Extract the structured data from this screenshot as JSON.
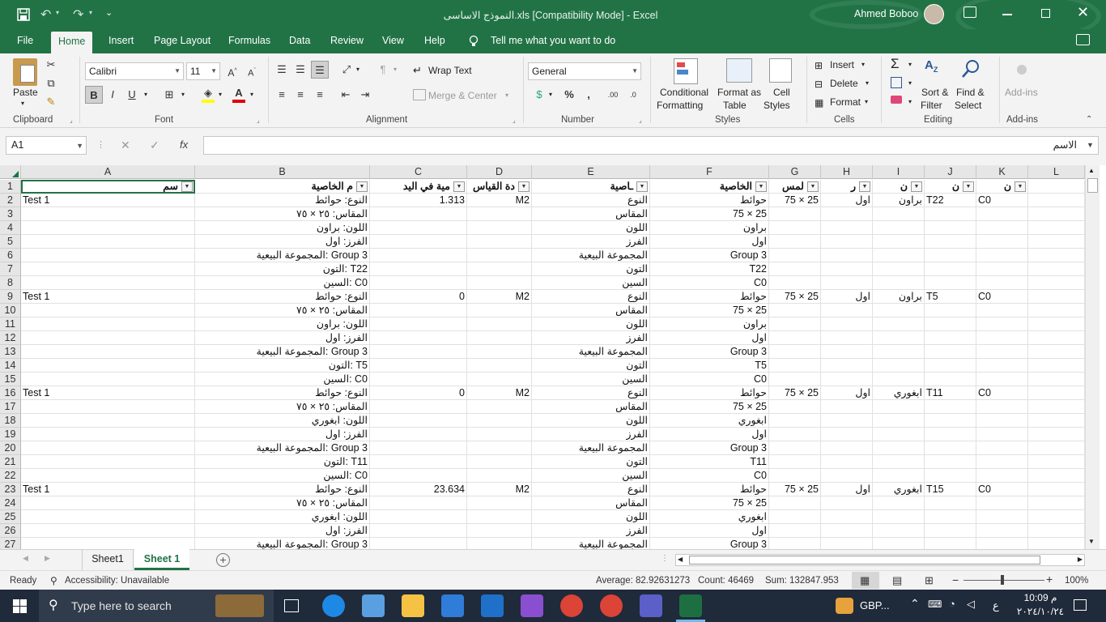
{
  "window": {
    "title": "النموذج الاساسى.xls  [Compatibility Mode]  -  Excel",
    "user": "Ahmed Boboo"
  },
  "ribbon_tabs": [
    "File",
    "Home",
    "Insert",
    "Page Layout",
    "Formulas",
    "Data",
    "Review",
    "View",
    "Help"
  ],
  "tell_me": "Tell me what you want to do",
  "clipboard": {
    "paste": "Paste",
    "label": "Clipboard"
  },
  "font": {
    "name": "Calibri",
    "size": "11",
    "bold": "B",
    "italic": "I",
    "underline": "U",
    "label": "Font"
  },
  "alignment": {
    "wrap": "Wrap Text",
    "merge": "Merge & Center",
    "label": "Alignment"
  },
  "number": {
    "format": "General",
    "label": "Number"
  },
  "styles": {
    "conditional": "Conditional",
    "formatting": "Formatting",
    "format_as": "Format as",
    "table": "Table",
    "cell": "Cell",
    "styles_txt": "Styles",
    "label": "Styles"
  },
  "cells": {
    "insert": "Insert",
    "delete": "Delete",
    "format": "Format",
    "label": "Cells"
  },
  "editing": {
    "sort": "Sort &",
    "filter": "Filter",
    "find": "Find &",
    "select": "Select",
    "label": "Editing"
  },
  "addins": {
    "btn": "Add-ins",
    "label": "Add-ins"
  },
  "formula_bar": {
    "name_box": "A1",
    "fx": "fx",
    "content": "الاسم"
  },
  "columns": [
    "A",
    "B",
    "C",
    "D",
    "E",
    "F",
    "G",
    "H",
    "I",
    "J",
    "K",
    "L"
  ],
  "header_row": [
    "سم",
    "م الخاصية",
    "مية في اليد",
    "دة القياس",
    "ـاصية",
    "الخاصية",
    "لمس",
    "ر",
    "ن",
    "ن",
    "ن",
    ""
  ],
  "rows": [
    {
      "n": "2",
      "a": "Test 1",
      "b": "النوع: حوائط",
      "c": "1.313",
      "d": "M2",
      "e": "النوع",
      "f": "حوائط",
      "g": "75 × 25",
      "h": "اول",
      "i": "براون",
      "j": "T22",
      "k": "C0"
    },
    {
      "n": "3",
      "a": "",
      "b": "المقاس: ٢٥ × ٧٥",
      "c": "",
      "d": "",
      "e": "المقاس",
      "f": "75 × 25",
      "g": "",
      "h": "",
      "i": "",
      "j": "",
      "k": ""
    },
    {
      "n": "4",
      "a": "",
      "b": "اللون: براون",
      "c": "",
      "d": "",
      "e": "اللون",
      "f": "براون",
      "g": "",
      "h": "",
      "i": "",
      "j": "",
      "k": ""
    },
    {
      "n": "5",
      "a": "",
      "b": "الفرز: اول",
      "c": "",
      "d": "",
      "e": "الفرز",
      "f": "اول",
      "g": "",
      "h": "",
      "i": "",
      "j": "",
      "k": ""
    },
    {
      "n": "6",
      "a": "",
      "b": "المجموعة البيعية: Group 3",
      "c": "",
      "d": "",
      "e": "المجموعة البيعية",
      "f": "Group 3",
      "g": "",
      "h": "",
      "i": "",
      "j": "",
      "k": ""
    },
    {
      "n": "7",
      "a": "",
      "b": "التون: T22",
      "c": "",
      "d": "",
      "e": "التون",
      "f": "T22",
      "g": "",
      "h": "",
      "i": "",
      "j": "",
      "k": ""
    },
    {
      "n": "8",
      "a": "",
      "b": "السين: C0",
      "c": "",
      "d": "",
      "e": "السين",
      "f": "C0",
      "g": "",
      "h": "",
      "i": "",
      "j": "",
      "k": ""
    },
    {
      "n": "9",
      "a": "Test 1",
      "b": "النوع: حوائط",
      "c": "0",
      "d": "M2",
      "e": "النوع",
      "f": "حوائط",
      "g": "75 × 25",
      "h": "اول",
      "i": "براون",
      "j": "T5",
      "k": "C0"
    },
    {
      "n": "10",
      "a": "",
      "b": "المقاس: ٢٥ × ٧٥",
      "c": "",
      "d": "",
      "e": "المقاس",
      "f": "75 × 25",
      "g": "",
      "h": "",
      "i": "",
      "j": "",
      "k": ""
    },
    {
      "n": "11",
      "a": "",
      "b": "اللون: براون",
      "c": "",
      "d": "",
      "e": "اللون",
      "f": "براون",
      "g": "",
      "h": "",
      "i": "",
      "j": "",
      "k": ""
    },
    {
      "n": "12",
      "a": "",
      "b": "الفرز: اول",
      "c": "",
      "d": "",
      "e": "الفرز",
      "f": "اول",
      "g": "",
      "h": "",
      "i": "",
      "j": "",
      "k": ""
    },
    {
      "n": "13",
      "a": "",
      "b": "المجموعة البيعية: Group 3",
      "c": "",
      "d": "",
      "e": "المجموعة البيعية",
      "f": "Group 3",
      "g": "",
      "h": "",
      "i": "",
      "j": "",
      "k": ""
    },
    {
      "n": "14",
      "a": "",
      "b": "التون: T5",
      "c": "",
      "d": "",
      "e": "التون",
      "f": "T5",
      "g": "",
      "h": "",
      "i": "",
      "j": "",
      "k": ""
    },
    {
      "n": "15",
      "a": "",
      "b": "السين: C0",
      "c": "",
      "d": "",
      "e": "السين",
      "f": "C0",
      "g": "",
      "h": "",
      "i": "",
      "j": "",
      "k": ""
    },
    {
      "n": "16",
      "a": "Test 1",
      "b": "النوع: حوائط",
      "c": "0",
      "d": "M2",
      "e": "النوع",
      "f": "حوائط",
      "g": "75 × 25",
      "h": "اول",
      "i": "ابغوري",
      "j": "T11",
      "k": "C0"
    },
    {
      "n": "17",
      "a": "",
      "b": "المقاس: ٢٥ × ٧٥",
      "c": "",
      "d": "",
      "e": "المقاس",
      "f": "75 × 25",
      "g": "",
      "h": "",
      "i": "",
      "j": "",
      "k": ""
    },
    {
      "n": "18",
      "a": "",
      "b": "اللون: ابغوري",
      "c": "",
      "d": "",
      "e": "اللون",
      "f": "ابغوري",
      "g": "",
      "h": "",
      "i": "",
      "j": "",
      "k": ""
    },
    {
      "n": "19",
      "a": "",
      "b": "الفرز: اول",
      "c": "",
      "d": "",
      "e": "الفرز",
      "f": "اول",
      "g": "",
      "h": "",
      "i": "",
      "j": "",
      "k": ""
    },
    {
      "n": "20",
      "a": "",
      "b": "المجموعة البيعية: Group 3",
      "c": "",
      "d": "",
      "e": "المجموعة البيعية",
      "f": "Group 3",
      "g": "",
      "h": "",
      "i": "",
      "j": "",
      "k": ""
    },
    {
      "n": "21",
      "a": "",
      "b": "التون: T11",
      "c": "",
      "d": "",
      "e": "التون",
      "f": "T11",
      "g": "",
      "h": "",
      "i": "",
      "j": "",
      "k": ""
    },
    {
      "n": "22",
      "a": "",
      "b": "السين: C0",
      "c": "",
      "d": "",
      "e": "السين",
      "f": "C0",
      "g": "",
      "h": "",
      "i": "",
      "j": "",
      "k": ""
    },
    {
      "n": "23",
      "a": "Test 1",
      "b": "النوع: حوائط",
      "c": "23.634",
      "d": "M2",
      "e": "النوع",
      "f": "حوائط",
      "g": "75 × 25",
      "h": "اول",
      "i": "ابغوري",
      "j": "T15",
      "k": "C0"
    },
    {
      "n": "24",
      "a": "",
      "b": "المقاس: ٢٥ × ٧٥",
      "c": "",
      "d": "",
      "e": "المقاس",
      "f": "75 × 25",
      "g": "",
      "h": "",
      "i": "",
      "j": "",
      "k": ""
    },
    {
      "n": "25",
      "a": "",
      "b": "اللون: ابغوري",
      "c": "",
      "d": "",
      "e": "اللون",
      "f": "ابغوري",
      "g": "",
      "h": "",
      "i": "",
      "j": "",
      "k": ""
    },
    {
      "n": "26",
      "a": "",
      "b": "الفرز: اول",
      "c": "",
      "d": "",
      "e": "الفرز",
      "f": "اول",
      "g": "",
      "h": "",
      "i": "",
      "j": "",
      "k": ""
    },
    {
      "n": "27",
      "a": "",
      "b": "المجموعة البيعية: Group 3",
      "c": "",
      "d": "",
      "e": "المجموعة البيعية",
      "f": "Group 3",
      "g": "",
      "h": "",
      "i": "",
      "j": "",
      "k": ""
    }
  ],
  "sheets": [
    "Sheet1",
    "Sheet 1"
  ],
  "status": {
    "ready": "Ready",
    "accessibility": "Accessibility: Unavailable",
    "average": "Average: 82.92631273",
    "count": "Count: 46469",
    "sum": "Sum: 132847.953",
    "zoom": "100%"
  },
  "taskbar": {
    "search": "Type here to search",
    "weather": "GBP...",
    "time": "10:09 م",
    "date": "٢٠٢٤/١٠/٢٤",
    "lang": "ع"
  },
  "colors": {
    "excel_green": "#217346",
    "taskbar": "#1f2a3a"
  }
}
